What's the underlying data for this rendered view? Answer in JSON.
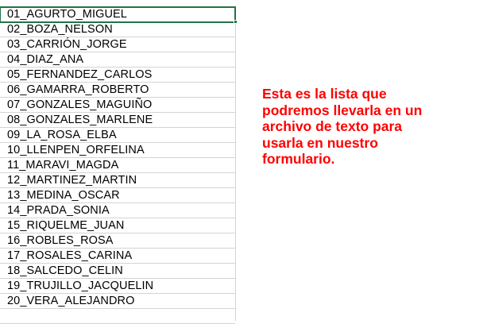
{
  "sheet": {
    "rows": [
      "01_AGURTO_MIGUEL",
      "02_BOZA_NELSON",
      "03_CARRIÓN_JORGE",
      "04_DIAZ_ANA",
      "05_FERNANDEZ_CARLOS",
      "06_GAMARRA_ROBERTO",
      "07_GONZALES_MAGUIÑO",
      "08_GONZALES_MARLENE",
      "09_LA_ROSA_ELBA",
      "10_LLENPEN_ORFELINA",
      "11_MARAVI_MAGDA",
      "12_MARTINEZ_MARTIN",
      "13_MEDINA_OSCAR",
      "14_PRADA_SONIA",
      "15_RIQUELME_JUAN",
      "16_ROBLES_ROSA",
      "17_ROSALES_CARINA",
      "18_SALCEDO_CELIN",
      "19_TRUJILLO_JACQUELIN",
      "20_VERA_ALEJANDRO"
    ],
    "selected_row": 0,
    "selection_color": "#217346",
    "grid_color": "#d4d4d4"
  },
  "note": {
    "text": "Esta es la lista que\npodremos llevarla en un\narchivo de texto para\nusarla en nuestro\nformulario.",
    "color": "#ff0000"
  }
}
